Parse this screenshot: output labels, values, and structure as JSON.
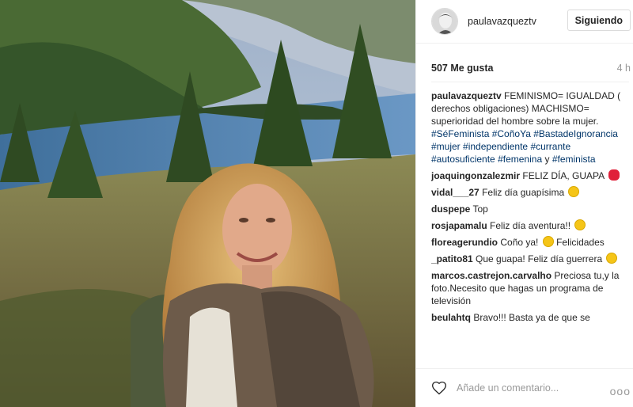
{
  "header": {
    "username": "paulavazqueztv",
    "follow_label": "Siguiendo"
  },
  "stats": {
    "likes": "507 Me gusta",
    "time": "4 h"
  },
  "caption": {
    "author": "paulavazqueztv",
    "text": "FEMINISMO= IGUALDAD ( derechos obligaciones) MACHISMO= superioridad del hombre sobre la mujer.",
    "hashtags": [
      "#SéFeminista",
      "#CoñoYa",
      "#BastadeIgnorancia",
      "#mujer",
      "#independiente",
      "#currante",
      "#autosuficiente",
      "#femenina"
    ],
    "connector": "y",
    "last_hashtag": "#feminista"
  },
  "comments": [
    {
      "author": "joaquingonzalezmir",
      "text": "FELIZ DÍA, GUAPA",
      "emoji": "kiss"
    },
    {
      "author": "vidal___27",
      "text": "Feliz día guapísima",
      "emoji": "smile"
    },
    {
      "author": "duspepe",
      "text": "Top",
      "emoji": ""
    },
    {
      "author": "rosjapamalu",
      "text": "Feliz día aventura!!",
      "emoji": "smile"
    },
    {
      "author": "floreagerundio",
      "text": "Coño ya!",
      "emoji": "laugh",
      "text2": "Felicidades"
    },
    {
      "author": "_patito81",
      "text": "Que guapa! Feliz día guerrera",
      "emoji": "grin"
    },
    {
      "author": "marcos.castrejon.carvalho",
      "text": "Preciosa tu,y la foto.Necesito que hagas un programa de televisión",
      "emoji": ""
    },
    {
      "author": "beulahtq",
      "text": "Bravo!!! Basta ya de que se",
      "emoji": ""
    }
  ],
  "add_comment": {
    "placeholder": "Añade un comentario..."
  },
  "more_label": "ooo"
}
